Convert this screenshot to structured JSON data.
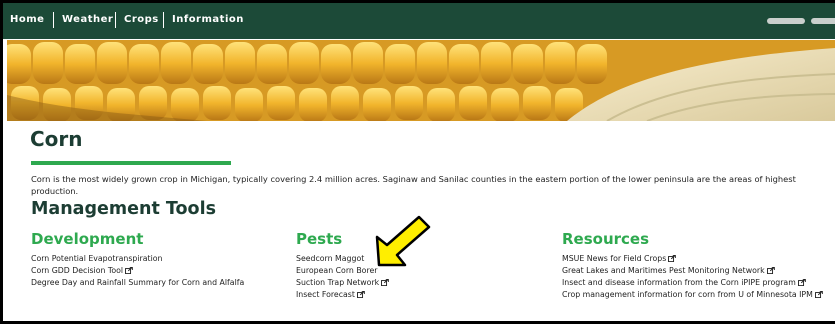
{
  "nav": {
    "items": [
      "Home",
      "Weather",
      "Crops",
      "Information"
    ]
  },
  "page": {
    "title": "Corn",
    "intro": "Corn is the most widely grown crop in Michigan, typically covering 2.4 million acres. Saginaw and Sanilac counties in the eastern portion of the lower peninsula are the areas of highest production.",
    "section_title": "Management Tools"
  },
  "columns": {
    "development": {
      "heading": "Development",
      "links": [
        "Corn Potential Evapotranspiration",
        "Corn GDD Decision Tool",
        "Degree Day and Rainfall Summary for Corn and Alfalfa"
      ]
    },
    "pests": {
      "heading": "Pests",
      "links": [
        "Seedcorn Maggot",
        "European Corn Borer",
        "Suction Trap Network",
        "Insect Forecast"
      ]
    },
    "resources": {
      "heading": "Resources",
      "links": [
        "MSUE News for Field Crops",
        "Great Lakes and Maritimes Pest Monitoring Network",
        "Insect and disease information from the Corn iPIPE program",
        "Crop management information for corn from U of Minnesota IPM"
      ]
    }
  },
  "colors": {
    "nav_bg": "#1c4a38",
    "heading_dark": "#1c3d33",
    "accent_green": "#2ea94f",
    "highlight_arrow": "#ffee00"
  },
  "icons": {
    "external_link": "external-link-icon",
    "annotation": "yellow-arrow-annotation"
  }
}
